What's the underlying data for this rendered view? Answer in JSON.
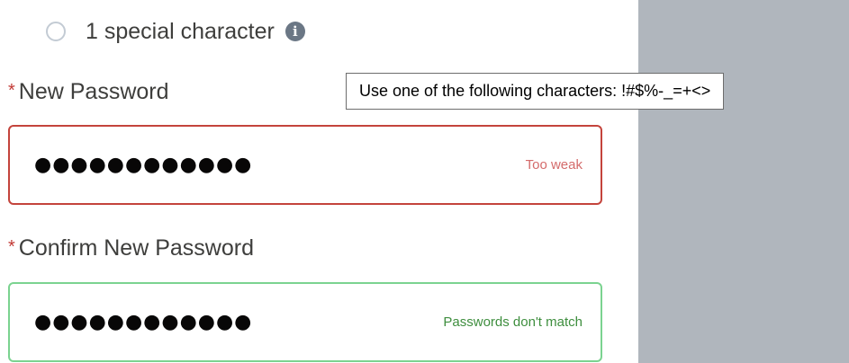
{
  "requirement": {
    "text": "1 special character",
    "info_icon": "info-icon"
  },
  "tooltip": {
    "text": "Use one of the following characters: !#$%-_=+<>"
  },
  "new_password": {
    "required_marker": "*",
    "label": "New Password",
    "masked_value": "●●●●●●●●●●●●",
    "status": "Too weak",
    "status_color": "#d46b6b",
    "border_color": "#c4443c"
  },
  "confirm_password": {
    "required_marker": "*",
    "label": "Confirm New Password",
    "masked_value": "●●●●●●●●●●●●",
    "status": "Passwords don't match",
    "status_color": "#3e8e3e",
    "border_color": "#7bd390"
  },
  "side_panel_color": "#b0b6bd"
}
